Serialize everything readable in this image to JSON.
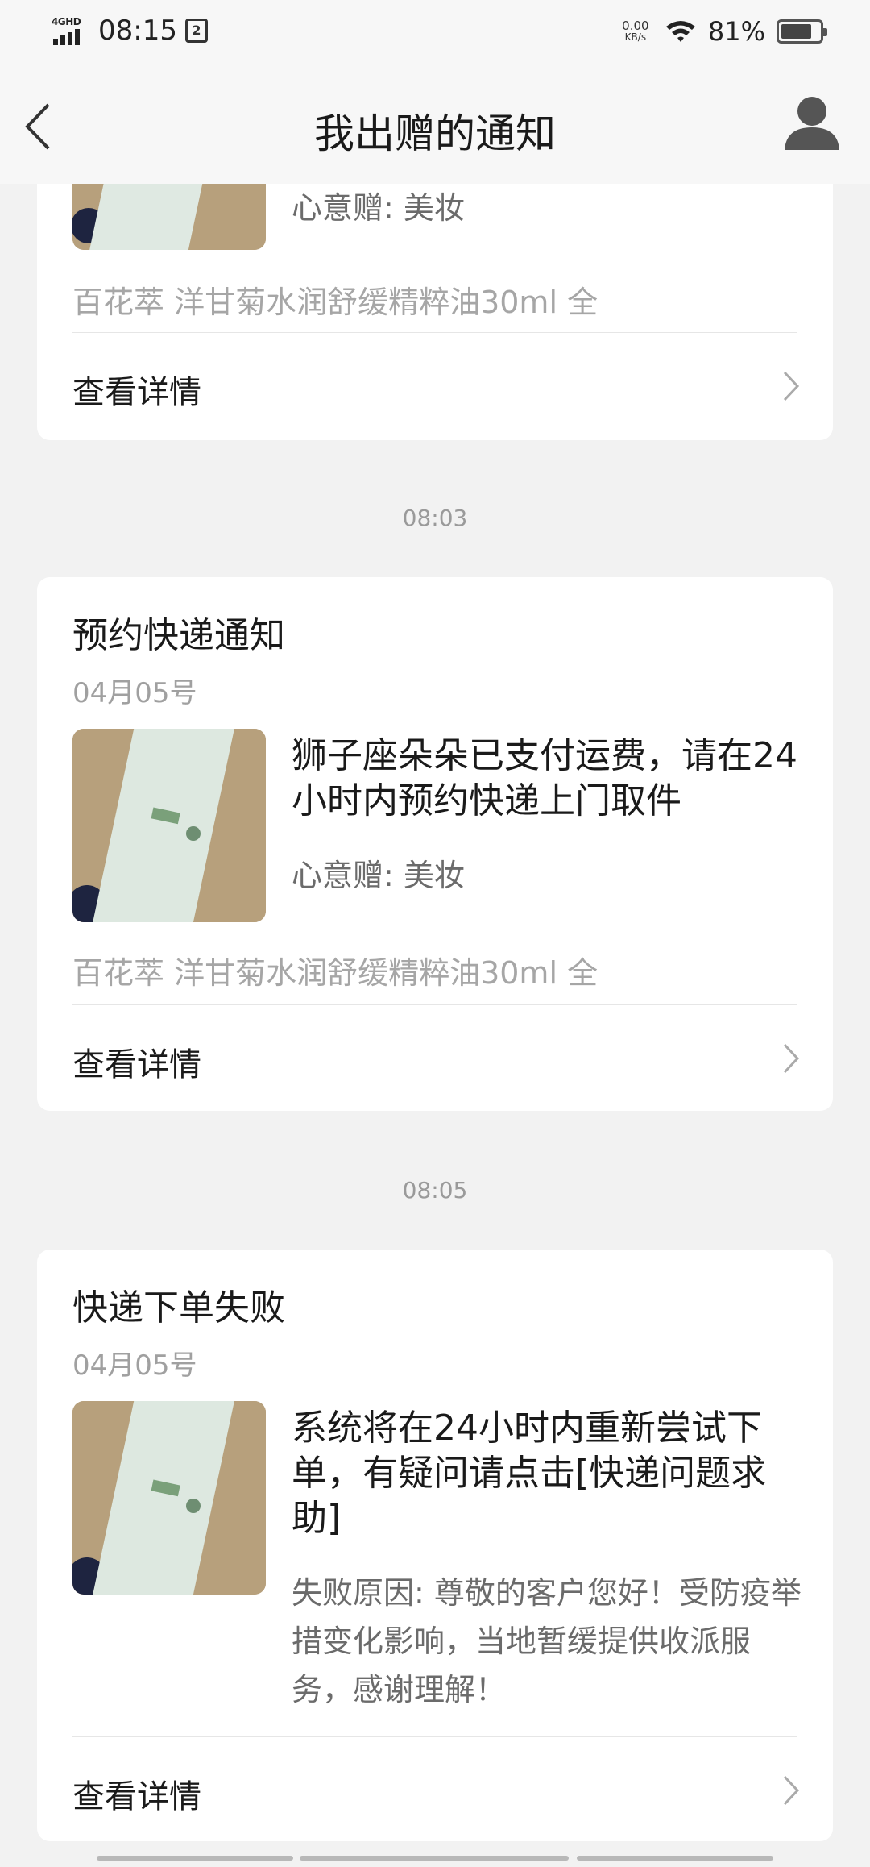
{
  "status_bar": {
    "network": "4GHD",
    "time": "08:15",
    "notification_glyph": "2",
    "speed_value": "0.00",
    "speed_unit": "KB/s",
    "battery_percent": "81%",
    "battery_level": 0.81
  },
  "nav": {
    "title": "我出赠的通知"
  },
  "cards": [
    {
      "sub": "心意赠: 美妆",
      "product": "百花萃 洋甘菊水润舒缓精粹油30ml 全",
      "detail_label": "查看详情"
    },
    {
      "timestamp": "08:03",
      "title": "预约快递通知",
      "date": "04月05号",
      "message": "狮子座朵朵已支付运费，请在24小时内预约快递上门取件",
      "sub": "心意赠: 美妆",
      "product": "百花萃 洋甘菊水润舒缓精粹油30ml 全",
      "detail_label": "查看详情"
    },
    {
      "timestamp": "08:05",
      "title": "快递下单失败",
      "date": "04月05号",
      "message": "系统将在24小时内重新尝试下单，有疑问请点击[快递问题求助]",
      "sub": "失败原因: 尊敬的客户您好！受防疫举措变化影响，当地暂缓提供收派服务，感谢理解！",
      "detail_label": "查看详情"
    }
  ],
  "icons": {
    "back": "back-arrow-icon",
    "avatar": "user-avatar-icon",
    "chevron": "chevron-right-icon",
    "wifi": "wifi-icon",
    "battery": "battery-icon",
    "signal": "signal-icon"
  },
  "colors": {
    "background": "#f2f2f2",
    "card": "#ffffff",
    "primary_text": "#1a1a1a",
    "secondary_text": "#6b6b6b",
    "muted_text": "#a6a6a6"
  }
}
